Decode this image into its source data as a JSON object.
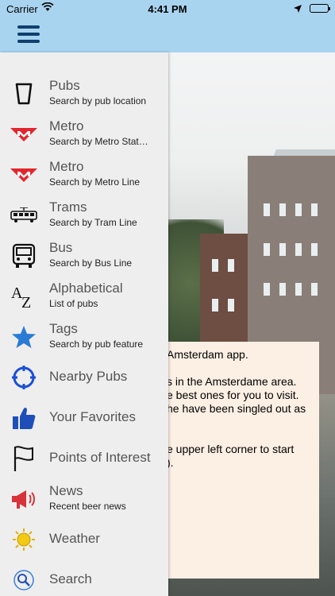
{
  "status_bar": {
    "carrier": "Carrier",
    "time": "4:41 PM"
  },
  "menu": {
    "items": [
      {
        "title": "Pubs",
        "subtitle": "Search by pub location",
        "icon": "pint-glass-icon"
      },
      {
        "title": "Metro",
        "subtitle": "Search by Metro Stat…",
        "icon": "metro-logo-icon"
      },
      {
        "title": "Metro",
        "subtitle": "Search by Metro Line",
        "icon": "metro-logo-icon"
      },
      {
        "title": "Trams",
        "subtitle": "Search by Tram Line",
        "icon": "tram-icon"
      },
      {
        "title": "Bus",
        "subtitle": "Search by Bus Line",
        "icon": "bus-icon"
      },
      {
        "title": "Alphabetical",
        "subtitle": "List of pubs",
        "icon": "az-icon"
      },
      {
        "title": "Tags",
        "subtitle": "Search by pub feature",
        "icon": "star-icon"
      },
      {
        "title": "Nearby Pubs",
        "icon": "location-target-icon"
      },
      {
        "title": "Your Favorites",
        "icon": "thumbs-up-icon"
      },
      {
        "title": "Points of Interest",
        "icon": "flag-icon"
      },
      {
        "title": "News",
        "subtitle": "Recent beer news",
        "icon": "megaphone-icon"
      },
      {
        "title": "Weather",
        "icon": "sun-icon"
      },
      {
        "title": "Search",
        "icon": "magnifier-icon"
      }
    ]
  },
  "welcome": {
    "lines": [
      "Amsterdam app.",
      "s in the Amsterdame area.",
      "e best ones for you to visit.",
      "he have been singled out as",
      "e upper left corner to start",
      ")."
    ]
  },
  "colors": {
    "nav_bar": "#a9d4f0",
    "menu_icon": "#0f3f6e",
    "card": "#fcefe3",
    "metro_red": "#e2262e",
    "accent_blue": "#2a7bd6"
  }
}
